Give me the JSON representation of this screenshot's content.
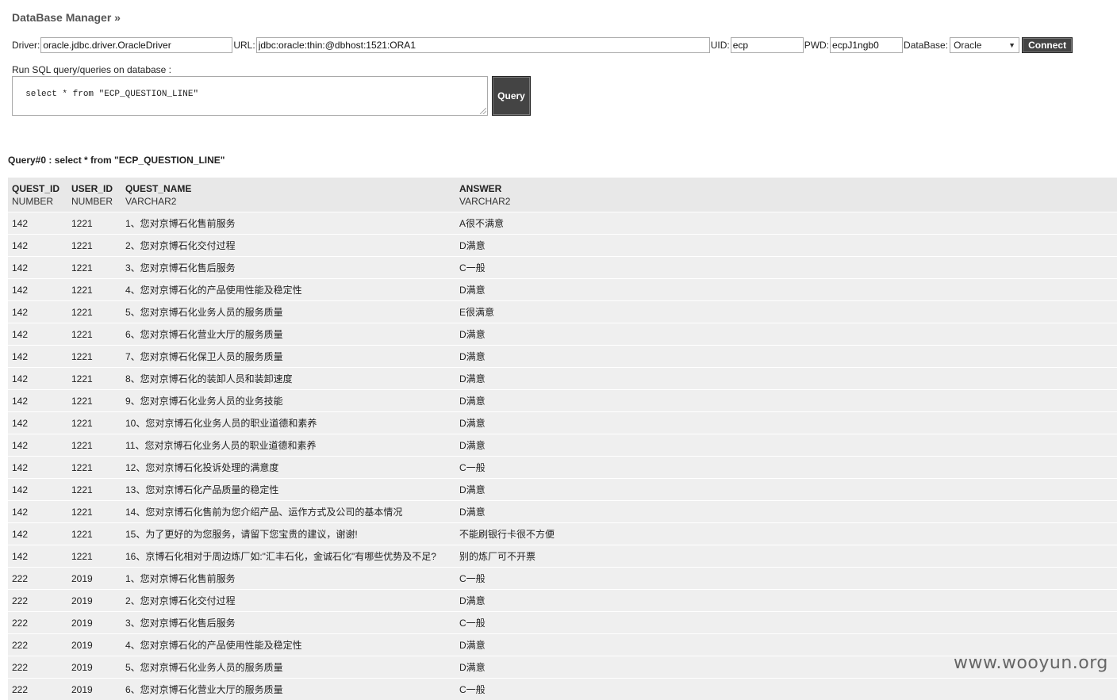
{
  "title": "DataBase Manager »",
  "connection": {
    "driver_label": "Driver:",
    "driver_value": "oracle.jdbc.driver.OracleDriver",
    "url_label": "URL:",
    "url_value": "jdbc:oracle:thin:@dbhost:1521:ORA1",
    "uid_label": "UID:",
    "uid_value": "ecp",
    "pwd_label": "PWD:",
    "pwd_value": "ecpJ1ngb0",
    "database_label": "DataBase:",
    "database_selected": "Oracle",
    "connect_label": "Connect"
  },
  "sql": {
    "label": "Run SQL query/queries on database :",
    "value": "select * from \"ECP_QUESTION_LINE\"",
    "query_button": "Query"
  },
  "result": {
    "heading": "Query#0 : select * from \"ECP_QUESTION_LINE\"",
    "columns": [
      {
        "name": "QUEST_ID",
        "type": "NUMBER"
      },
      {
        "name": "USER_ID",
        "type": "NUMBER"
      },
      {
        "name": "QUEST_NAME",
        "type": "VARCHAR2"
      },
      {
        "name": "ANSWER",
        "type": "VARCHAR2"
      }
    ],
    "rows": [
      [
        "142",
        "1221",
        "1、您对京博石化售前服务",
        "A很不满意"
      ],
      [
        "142",
        "1221",
        "2、您对京博石化交付过程",
        "D满意"
      ],
      [
        "142",
        "1221",
        "3、您对京博石化售后服务",
        "C一般"
      ],
      [
        "142",
        "1221",
        "4、您对京博石化的产品使用性能及稳定性",
        "D满意"
      ],
      [
        "142",
        "1221",
        "5、您对京博石化业务人员的服务质量",
        "E很满意"
      ],
      [
        "142",
        "1221",
        "6、您对京博石化营业大厅的服务质量",
        "D满意"
      ],
      [
        "142",
        "1221",
        "7、您对京博石化保卫人员的服务质量",
        "D满意"
      ],
      [
        "142",
        "1221",
        "8、您对京博石化的装卸人员和装卸速度",
        "D满意"
      ],
      [
        "142",
        "1221",
        "9、您对京博石化业务人员的业务技能",
        "D满意"
      ],
      [
        "142",
        "1221",
        "10、您对京博石化业务人员的职业道德和素养",
        "D满意"
      ],
      [
        "142",
        "1221",
        "11、您对京博石化业务人员的职业道德和素养",
        "D满意"
      ],
      [
        "142",
        "1221",
        "12、您对京博石化投诉处理的满意度",
        "C一般"
      ],
      [
        "142",
        "1221",
        "13、您对京博石化产品质量的稳定性",
        "D满意"
      ],
      [
        "142",
        "1221",
        "14、您对京博石化售前为您介绍产品、运作方式及公司的基本情况",
        "D满意"
      ],
      [
        "142",
        "1221",
        "15、为了更好的为您服务，请留下您宝贵的建议，谢谢!",
        "不能刷银行卡很不方便"
      ],
      [
        "142",
        "1221",
        "16、京博石化相对于周边炼厂如:\"汇丰石化，金诚石化\"有哪些优势及不足?",
        "别的炼厂可不开票"
      ],
      [
        "222",
        "2019",
        "1、您对京博石化售前服务",
        "C一般"
      ],
      [
        "222",
        "2019",
        "2、您对京博石化交付过程",
        "D满意"
      ],
      [
        "222",
        "2019",
        "3、您对京博石化售后服务",
        "C一般"
      ],
      [
        "222",
        "2019",
        "4、您对京博石化的产品使用性能及稳定性",
        "D满意"
      ],
      [
        "222",
        "2019",
        "5、您对京博石化业务人员的服务质量",
        "D满意"
      ],
      [
        "222",
        "2019",
        "6、您对京博石化营业大厅的服务质量",
        "C一般"
      ]
    ]
  },
  "watermark": "www.wooyun.org"
}
